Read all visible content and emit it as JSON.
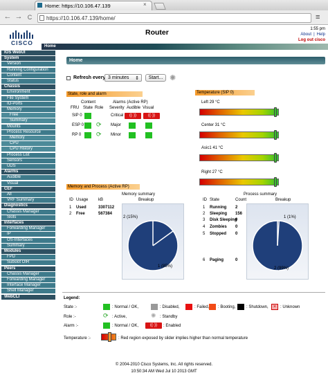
{
  "browser": {
    "tab_title": "Home: https://10.106.47.139",
    "url": "https://10.106.47.139/home/",
    "back": "←",
    "forward": "→",
    "reload": "C",
    "menu": "≡",
    "close": "×"
  },
  "header": {
    "logo": "CISCO",
    "title": "Router",
    "time": "1:55 pm",
    "about": "About",
    "help": "Help",
    "logout": "Log out cisco",
    "banner_label": "Home"
  },
  "sidebar": {
    "items": [
      {
        "label": "IOS WebUI",
        "level": "h"
      },
      {
        "label": "System",
        "level": "h"
      },
      {
        "label": "Version",
        "level": "i"
      },
      {
        "label": "Running Configuration",
        "level": "i"
      },
      {
        "label": "Content",
        "level": "i"
      },
      {
        "label": "Status",
        "level": "i"
      },
      {
        "label": "Chassis",
        "level": "h"
      },
      {
        "label": "Environment",
        "level": "i"
      },
      {
        "label": "File System",
        "level": "i"
      },
      {
        "label": "IO-Ports",
        "level": "i"
      },
      {
        "label": "Memory",
        "level": "i"
      },
      {
        "label": "Free",
        "level": "s"
      },
      {
        "label": "Summary",
        "level": "s"
      },
      {
        "label": "Mounts",
        "level": "i"
      },
      {
        "label": "Process Resource",
        "level": "i"
      },
      {
        "label": "Memory",
        "level": "s"
      },
      {
        "label": "CPU",
        "level": "s"
      },
      {
        "label": "CPU History",
        "level": "s"
      },
      {
        "label": "Process List",
        "level": "i"
      },
      {
        "label": "Sensors",
        "level": "i"
      },
      {
        "label": "UDS",
        "level": "i"
      },
      {
        "label": "Alarms",
        "level": "h"
      },
      {
        "label": "Audible",
        "level": "i"
      },
      {
        "label": "Visual",
        "level": "i"
      },
      {
        "label": "CEF",
        "level": "h"
      },
      {
        "label": "All",
        "level": "i"
      },
      {
        "label": "VRF Summary",
        "level": "i"
      },
      {
        "label": "Diagnostics",
        "level": "h"
      },
      {
        "label": "Chassis Manager",
        "level": "i"
      },
      {
        "label": "Slots",
        "level": "i"
      },
      {
        "label": "Interfaces",
        "level": "h"
      },
      {
        "label": "Forwarding Manager",
        "level": "i"
      },
      {
        "label": "IP",
        "level": "i"
      },
      {
        "label": "OS-Interfaces",
        "level": "i"
      },
      {
        "label": "Summary",
        "level": "i"
      },
      {
        "label": "Modules",
        "level": "h"
      },
      {
        "label": "FPD",
        "level": "i"
      },
      {
        "label": "Subslot OIR",
        "level": "i"
      },
      {
        "label": "Peers",
        "level": "h"
      },
      {
        "label": "Chassis Manager",
        "level": "i"
      },
      {
        "label": "Forwarding Manager",
        "level": "i"
      },
      {
        "label": "Interface Manager",
        "level": "i"
      },
      {
        "label": "Shell Manager",
        "level": "i"
      },
      {
        "label": "WebCLI",
        "level": "h"
      }
    ]
  },
  "main": {
    "home_title": "Home",
    "refresh_label": "Refresh every",
    "refresh_value": "3 minutes",
    "start_label": "Start...",
    "state_panel": {
      "title": "State, role and alarm",
      "content_header": "Content",
      "alarms_header": "Alarms (Active RP)",
      "col_fru": "FRU",
      "col_state": "State",
      "col_role": "Role",
      "col_severity": "Severity",
      "col_audible": "Audible",
      "col_visual": "Visual",
      "frus": [
        "SIP 0",
        "ESP 0",
        "RP 0"
      ],
      "severities": [
        "Critical",
        "Major",
        "Minor"
      ],
      "alarm_glyph": "((·))"
    },
    "temperature": {
      "title": "Temperature (SIP 0)",
      "sensors": [
        {
          "label": "Left 29 °C",
          "value": 29
        },
        {
          "label": "Center 31 °C",
          "value": 31
        },
        {
          "label": "Asic1 41 °C",
          "value": 41
        },
        {
          "label": "Right 27 °C",
          "value": 27
        }
      ]
    },
    "memory_process": {
      "title": "Memory and Process (Active RP)",
      "mem_summary_title": "Memory summary",
      "proc_summary_title": "Process summary",
      "mem_cols": [
        "ID",
        "Usage",
        "kB",
        "Breakup"
      ],
      "mem_rows": [
        {
          "id": "1",
          "usage": "Used",
          "kb": "3307112"
        },
        {
          "id": "2",
          "usage": "Free",
          "kb": "567384"
        }
      ],
      "proc_cols": [
        "ID",
        "State",
        "Count",
        "Breakup"
      ],
      "proc_rows": [
        {
          "id": "1",
          "state": "Running",
          "count": "2"
        },
        {
          "id": "2",
          "state": "Sleeping",
          "count": "156"
        },
        {
          "id": "3",
          "state": "Disk Sleeping",
          "count": "0"
        },
        {
          "id": "4",
          "state": "Zombies",
          "count": "0"
        },
        {
          "id": "5",
          "state": "Stopped",
          "count": "0"
        },
        {
          "id": "6",
          "state": "Paging",
          "count": "0"
        }
      ],
      "mem_pie": {
        "slice1_label": "1 (85%)",
        "slice2_label": "2 (15%)",
        "slice1": 85,
        "slice2": 15
      },
      "proc_pie": {
        "slice1_label": "1 (1%)",
        "slice2_label": "2 (99%)",
        "slice1": 1,
        "slice2": 99
      }
    },
    "legend": {
      "title": "Legend:",
      "state_label": "State :-",
      "role_label": "Role :-",
      "alarm_label": "Alarm :-",
      "temp_label": "Temperature :-",
      "normal_ok": ": Normal / OK,",
      "disabled": ": Disabled,",
      "failed": ": Failed,",
      "booting": ": Booting,",
      "shutdown": ": Shutdown,",
      "unknown": ": Unknown",
      "active": ": Active,",
      "standby": ": Standby",
      "enabled": ": Enabled",
      "alarm_normal": ": Normal / OK,",
      "temp_note": ": Red region exposed by slider implies higher than normal temperature"
    }
  },
  "footer": {
    "copyright": "© 2004-2010 Cisco Systems, Inc. All rights reserved.",
    "timestamp": "10:50:34 AM Wed Jul 10 2013 GMT"
  },
  "colors": {
    "green": "#22c022",
    "red": "#e81010",
    "orange": "#f59a2a",
    "pie_blue": "#1f3f7a",
    "sidebar_header": "#2e5061"
  }
}
